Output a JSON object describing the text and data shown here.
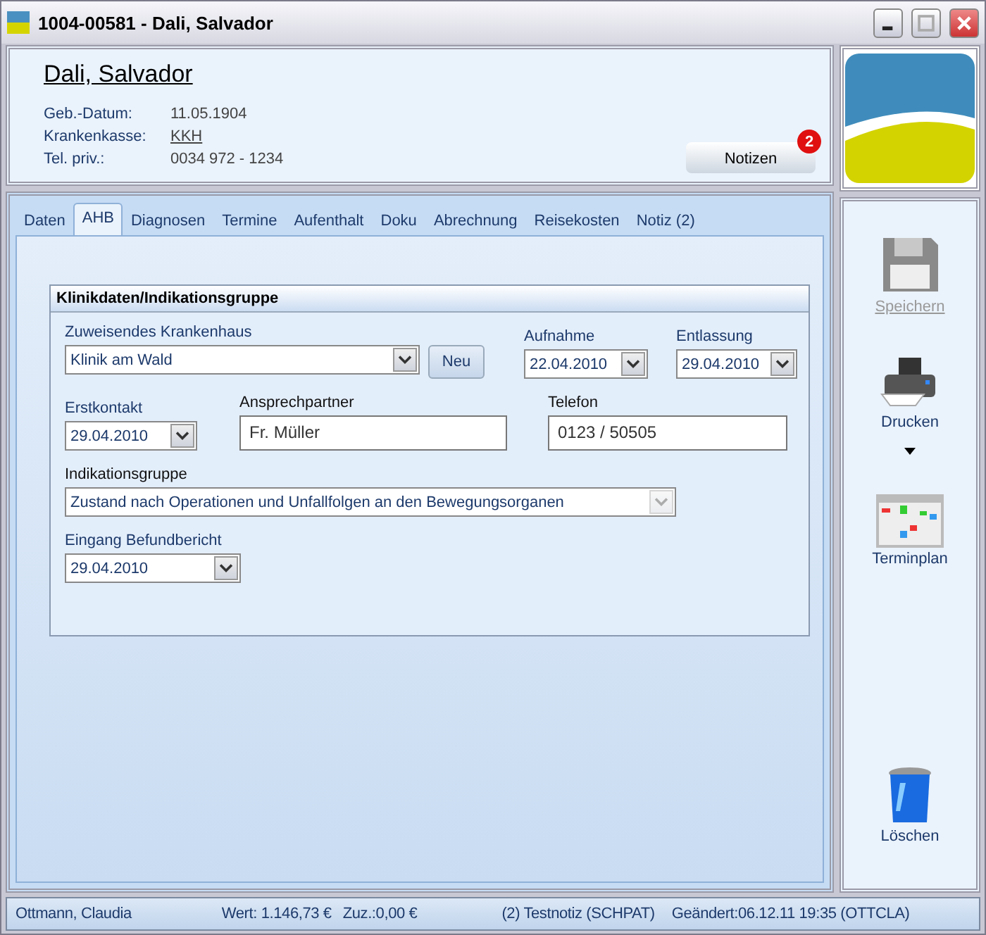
{
  "window": {
    "title": "1004-00581 - Dali, Salvador"
  },
  "header": {
    "name": "Dali, Salvador",
    "fields": [
      {
        "label": "Geb.-Datum:",
        "value": "11.05.1904",
        "kind": "text"
      },
      {
        "label": "Krankenkasse:",
        "value": "KKH",
        "kind": "link"
      },
      {
        "label": "Tel. priv.:",
        "value": "0034 972 - 1234",
        "kind": "text"
      }
    ],
    "notes_button": {
      "label": "Notizen",
      "badge": "2"
    }
  },
  "tabs": [
    {
      "label": "Daten",
      "selected": false
    },
    {
      "label": "AHB",
      "selected": true
    },
    {
      "label": "Diagnosen",
      "selected": false
    },
    {
      "label": "Termine",
      "selected": false
    },
    {
      "label": "Aufenthalt",
      "selected": false
    },
    {
      "label": "Doku",
      "selected": false
    },
    {
      "label": "Abrechnung",
      "selected": false
    },
    {
      "label": "Reisekosten",
      "selected": false
    },
    {
      "label": "Notiz (2)",
      "selected": false
    }
  ],
  "group": {
    "title": "Klinikdaten/Indikationsgruppe",
    "fields": [
      {
        "label": "Zuweisendes Krankenhaus",
        "value": "Klinik am Wald",
        "kind": "combo",
        "disabled": false,
        "button": "Neu"
      },
      {
        "label": "Aufnahme",
        "value": "22.04.2010",
        "kind": "combo",
        "disabled": false
      },
      {
        "label": "Entlassung",
        "value": "29.04.2010",
        "kind": "combo",
        "disabled": false
      },
      {
        "label": "Erstkontakt",
        "value": "29.04.2010",
        "kind": "combo",
        "disabled": false
      },
      {
        "label": "Ansprechpartner",
        "value": "Fr. Müller",
        "kind": "text"
      },
      {
        "label": "Telefon",
        "value": "0123 / 50505",
        "kind": "text"
      },
      {
        "label": "Indikationsgruppe",
        "value": "Zustand nach Operationen und Unfallfolgen an den Bewegungsorganen",
        "kind": "combo",
        "disabled": true
      },
      {
        "label": "Eingang Befundbericht",
        "value": "29.04.2010",
        "kind": "combo",
        "disabled": false
      }
    ]
  },
  "actions": [
    {
      "label": "Speichern",
      "kind": "disk",
      "disabled": true,
      "menu": false
    },
    {
      "label": "Drucken",
      "kind": "printer",
      "disabled": false,
      "menu": true
    },
    {
      "label": "Terminplan",
      "kind": "calendar",
      "disabled": false,
      "menu": false
    },
    {
      "label": "Löschen",
      "kind": "bin",
      "disabled": false,
      "menu": false
    }
  ],
  "status_bar": [
    "Ottmann, Claudia",
    "Wert: 1.146,73 €",
    "Zuz.:0,00 €",
    "(2) Testnotiz (SCHPAT)",
    "Geändert:06.12.11 19:35 (OTTCLA)"
  ]
}
